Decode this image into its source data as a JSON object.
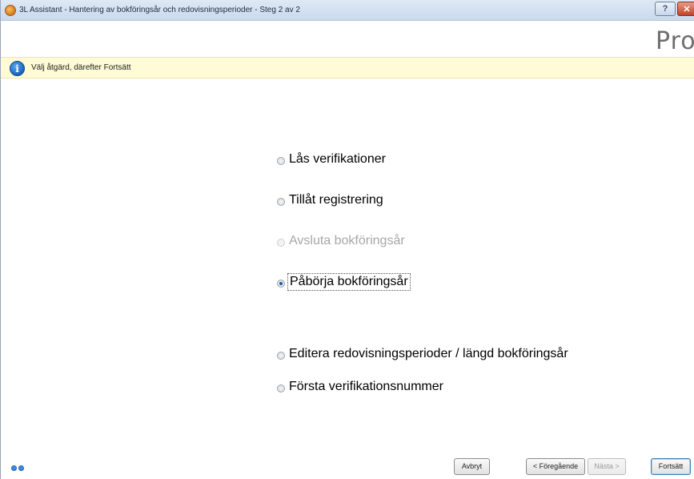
{
  "window": {
    "title": "3L Assistant - Hantering av bokföringsår och redovisningsperioder - Steg 2 av 2",
    "help_label": "?",
    "close_label": "✕",
    "logo_text": "Pro"
  },
  "info": {
    "icon_glyph": "i",
    "message": "Välj åtgärd, därefter Fortsätt"
  },
  "options": [
    {
      "label": "Lås verifikationer",
      "state": "enabled"
    },
    {
      "label": "Tillåt registrering",
      "state": "enabled"
    },
    {
      "label": "Avsluta bokföringsår",
      "state": "disabled"
    },
    {
      "label": "Påbörja bokföringsår",
      "state": "selected"
    },
    {
      "label": "Editera redovisningsperioder / längd bokföringsår",
      "state": "enabled"
    },
    {
      "label": "Första verifikationsnummer",
      "state": "enabled"
    }
  ],
  "buttons": {
    "cancel": "Avbryt",
    "previous": "< Föregående",
    "next": "Nästa >",
    "continue": "Fortsätt"
  },
  "colors": {
    "info_bar": "#fffbd6",
    "selected_radio": "#1e5ca8",
    "disabled_text": "#a7a7a7"
  }
}
